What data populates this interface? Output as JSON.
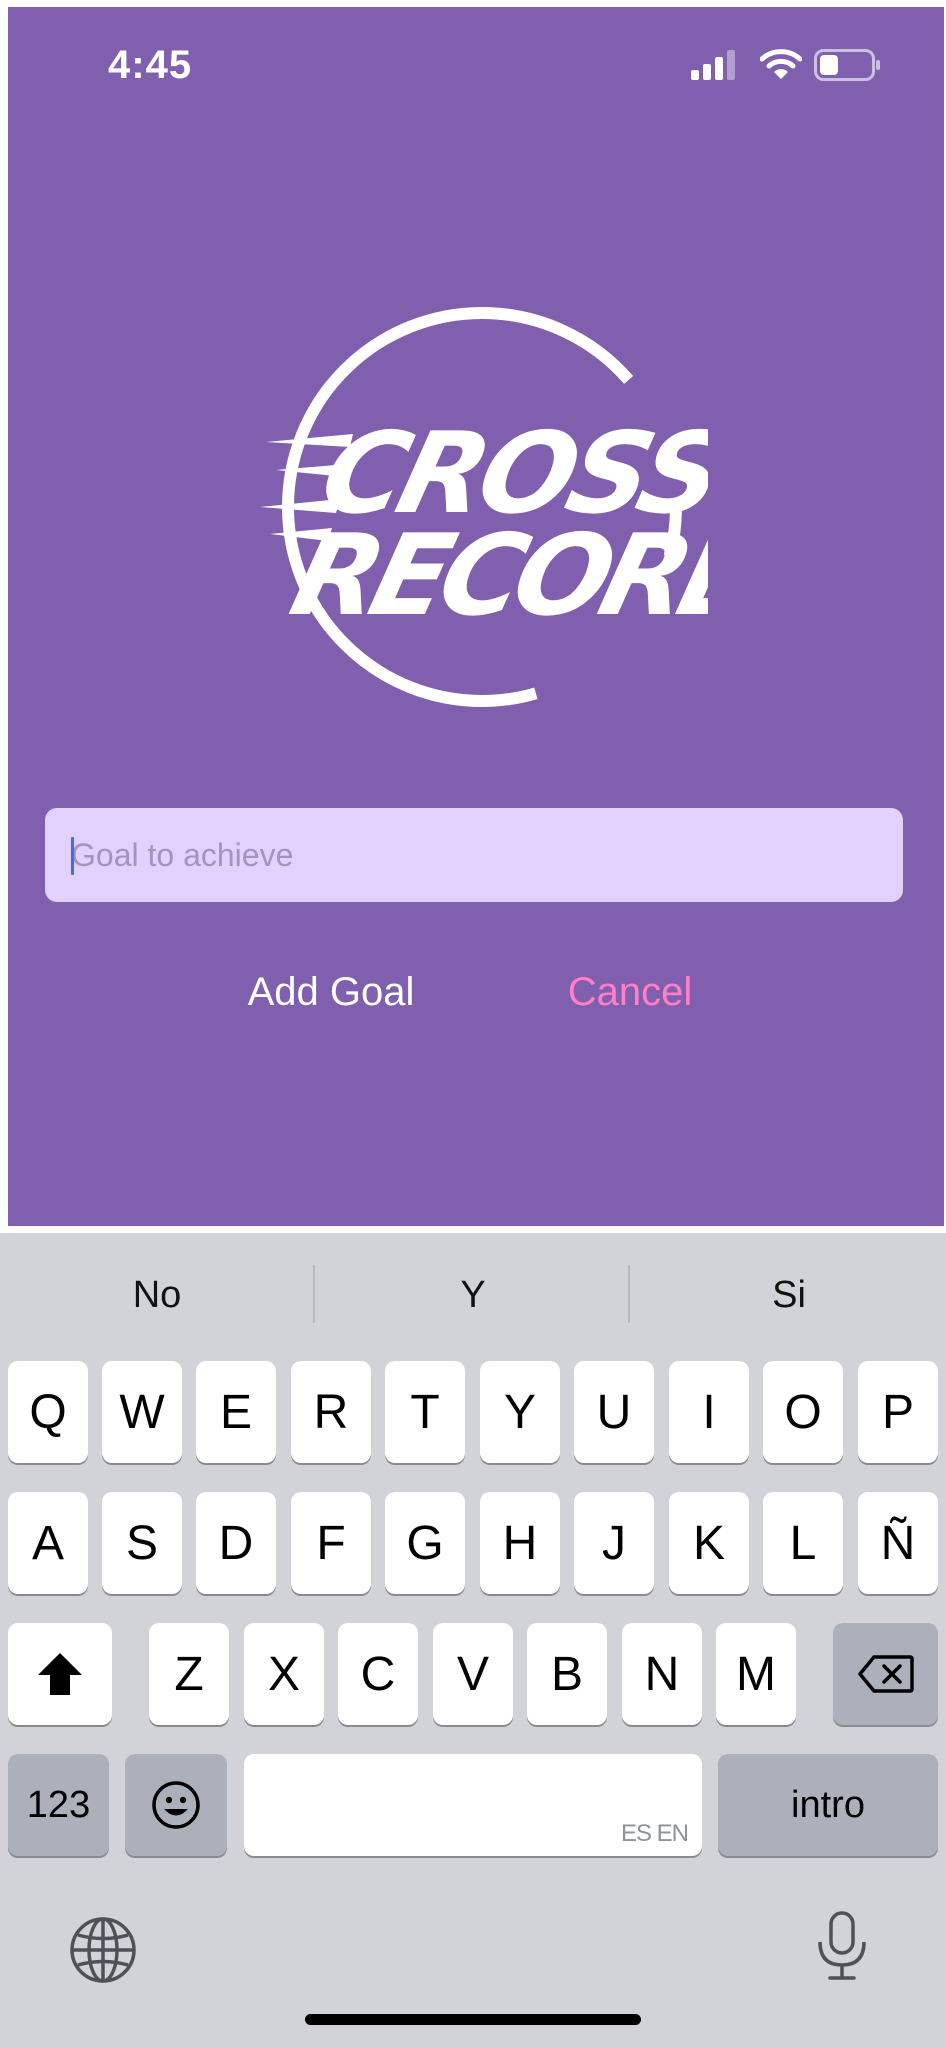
{
  "status_bar": {
    "time": "4:45",
    "signal_icon": "signal-bars-icon",
    "wifi_icon": "wifi-icon",
    "battery_icon": "battery-icon"
  },
  "logo": {
    "line_1": "CROSS",
    "line_2": "RECORD"
  },
  "form": {
    "goal_input": {
      "value": "",
      "placeholder": "Goal to achieve"
    },
    "add_goal_label": "Add Goal",
    "cancel_label": "Cancel"
  },
  "keyboard": {
    "suggestions": [
      "No",
      "Y",
      "Si"
    ],
    "row_1": [
      "Q",
      "W",
      "E",
      "R",
      "T",
      "Y",
      "U",
      "I",
      "O",
      "P"
    ],
    "row_2": [
      "A",
      "S",
      "D",
      "F",
      "G",
      "H",
      "J",
      "K",
      "L",
      "Ñ"
    ],
    "row_3": [
      "Z",
      "X",
      "C",
      "V",
      "B",
      "N",
      "M"
    ],
    "numbers_label": "123",
    "space_language_label": "ES EN",
    "return_label": "intro",
    "icons": {
      "shift": "shift-icon",
      "backspace": "backspace-icon",
      "emoji": "emoji-icon",
      "globe": "globe-icon",
      "mic": "microphone-icon"
    }
  },
  "colors": {
    "app_background": "#7f5fae",
    "input_background": "#e2d1fc",
    "cancel_text": "#ff7fc8",
    "keyboard_background": "#d1d3d9"
  }
}
